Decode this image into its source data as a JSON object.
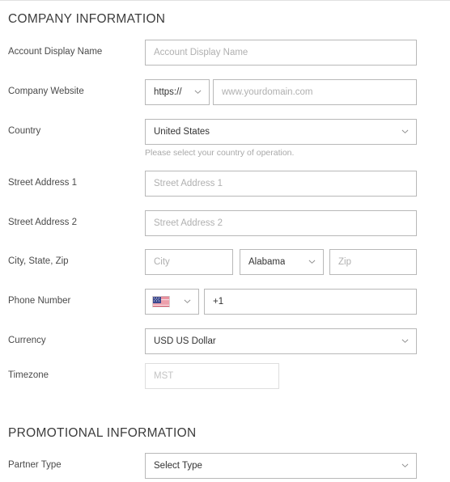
{
  "sections": {
    "company": {
      "title": "COMPANY INFORMATION"
    },
    "promotional": {
      "title": "PROMOTIONAL INFORMATION"
    }
  },
  "fields": {
    "account_display_name": {
      "label": "Account Display Name",
      "placeholder": "Account Display Name",
      "value": ""
    },
    "company_website": {
      "label": "Company Website",
      "protocol": "https://",
      "url_placeholder": "www.yourdomain.com",
      "url_value": ""
    },
    "country": {
      "label": "Country",
      "value": "United States",
      "helper": "Please select your country of operation."
    },
    "street_address_1": {
      "label": "Street Address 1",
      "placeholder": "Street Address 1",
      "value": ""
    },
    "street_address_2": {
      "label": "Street Address 2",
      "placeholder": "Street Address 2",
      "value": ""
    },
    "city_state_zip": {
      "label": "City, State, Zip",
      "city_placeholder": "City",
      "city_value": "",
      "state_value": "Alabama",
      "zip_placeholder": "Zip",
      "zip_value": ""
    },
    "phone_number": {
      "label": "Phone Number",
      "country_flag_icon": "us-flag-icon",
      "dial_code_value": "+1"
    },
    "currency": {
      "label": "Currency",
      "value": "USD US Dollar"
    },
    "timezone": {
      "label": "Timezone",
      "placeholder": "MST",
      "value": ""
    },
    "partner_type": {
      "label": "Partner Type",
      "value": "Select Type"
    }
  },
  "icons": {
    "chevron_down": "chevron-down-icon"
  },
  "colors": {
    "text": "#444444",
    "heading": "#3c3c3c",
    "border": "#b8b8b8",
    "border_muted": "#dedede",
    "placeholder": "#b0b0b0",
    "helper": "#a9a9a9",
    "background": "#ffffff"
  }
}
